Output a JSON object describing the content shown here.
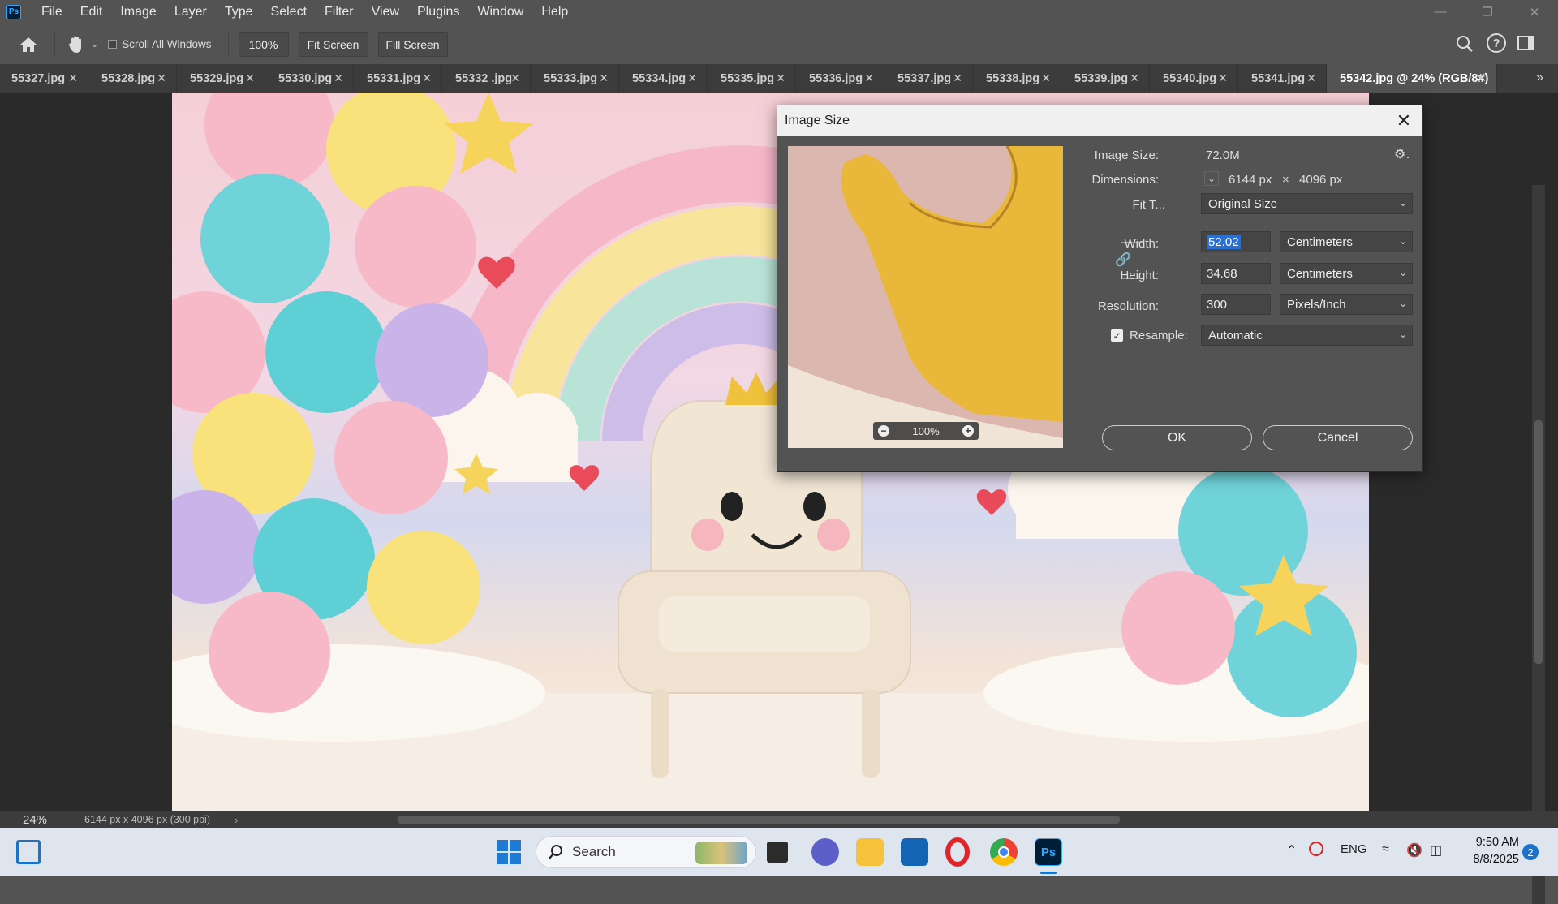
{
  "menubar": {
    "logo": "Ps",
    "items": [
      "File",
      "Edit",
      "Image",
      "Layer",
      "Type",
      "Select",
      "Filter",
      "View",
      "Plugins",
      "Window",
      "Help"
    ]
  },
  "optionsbar": {
    "scroll_all_windows": "Scroll All Windows",
    "zoom_value": "100%",
    "fit_screen": "Fit Screen",
    "fill_screen": "Fill Screen"
  },
  "tabs": [
    {
      "label": "55327.jpg"
    },
    {
      "label": "55328.jpg"
    },
    {
      "label": "55329.jpg"
    },
    {
      "label": "55330.jpg"
    },
    {
      "label": "55331.jpg"
    },
    {
      "label": "55332 .jpg"
    },
    {
      "label": "55333.jpg"
    },
    {
      "label": "55334.jpg"
    },
    {
      "label": "55335.jpg"
    },
    {
      "label": "55336.jpg"
    },
    {
      "label": "55337.jpg"
    },
    {
      "label": "55338.jpg"
    },
    {
      "label": "55339.jpg"
    },
    {
      "label": "55340.jpg"
    },
    {
      "label": "55341.jpg"
    },
    {
      "label": "55342.jpg @ 24% (RGB/8#)",
      "active": true
    }
  ],
  "statusbar": {
    "zoom": "24%",
    "doc_info": "6144 px x 4096 px (300 ppi)"
  },
  "dialog": {
    "title": "Image Size",
    "preview_zoom": "100%",
    "image_size_label": "Image Size:",
    "image_size_value": "72.0M",
    "dimensions_label": "Dimensions:",
    "dim_width": "6144 px",
    "dim_x": "×",
    "dim_height": "4096 px",
    "fit_to_label": "Fit T...",
    "fit_to_value": "Original Size",
    "width_label": "Width:",
    "width_value": "52.02",
    "width_unit": "Centimeters",
    "height_label": "Height:",
    "height_value": "34.68",
    "height_unit": "Centimeters",
    "resolution_label": "Resolution:",
    "resolution_value": "300",
    "resolution_unit": "Pixels/Inch",
    "resample_label": "Resample:",
    "resample_value": "Automatic",
    "ok": "OK",
    "cancel": "Cancel"
  },
  "taskbar": {
    "search_placeholder": "Search",
    "language": "ENG",
    "time": "9:50 AM",
    "date": "8/8/2025",
    "notification_count": "2"
  },
  "colors": {
    "ps_blue": "#31a8ff",
    "ui_gray": "#535353",
    "selection_blue": "#2a6fd6"
  }
}
